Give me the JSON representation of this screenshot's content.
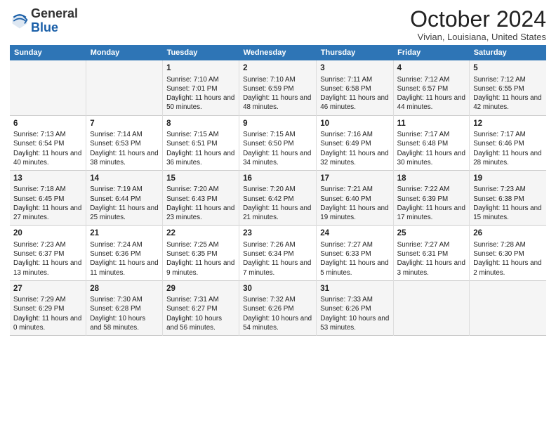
{
  "header": {
    "logo_general": "General",
    "logo_blue": "Blue",
    "month": "October 2024",
    "location": "Vivian, Louisiana, United States"
  },
  "days_of_week": [
    "Sunday",
    "Monday",
    "Tuesday",
    "Wednesday",
    "Thursday",
    "Friday",
    "Saturday"
  ],
  "weeks": [
    [
      {
        "day": "",
        "content": ""
      },
      {
        "day": "",
        "content": ""
      },
      {
        "day": "1",
        "content": "Sunrise: 7:10 AM\nSunset: 7:01 PM\nDaylight: 11 hours and 50 minutes."
      },
      {
        "day": "2",
        "content": "Sunrise: 7:10 AM\nSunset: 6:59 PM\nDaylight: 11 hours and 48 minutes."
      },
      {
        "day": "3",
        "content": "Sunrise: 7:11 AM\nSunset: 6:58 PM\nDaylight: 11 hours and 46 minutes."
      },
      {
        "day": "4",
        "content": "Sunrise: 7:12 AM\nSunset: 6:57 PM\nDaylight: 11 hours and 44 minutes."
      },
      {
        "day": "5",
        "content": "Sunrise: 7:12 AM\nSunset: 6:55 PM\nDaylight: 11 hours and 42 minutes."
      }
    ],
    [
      {
        "day": "6",
        "content": "Sunrise: 7:13 AM\nSunset: 6:54 PM\nDaylight: 11 hours and 40 minutes."
      },
      {
        "day": "7",
        "content": "Sunrise: 7:14 AM\nSunset: 6:53 PM\nDaylight: 11 hours and 38 minutes."
      },
      {
        "day": "8",
        "content": "Sunrise: 7:15 AM\nSunset: 6:51 PM\nDaylight: 11 hours and 36 minutes."
      },
      {
        "day": "9",
        "content": "Sunrise: 7:15 AM\nSunset: 6:50 PM\nDaylight: 11 hours and 34 minutes."
      },
      {
        "day": "10",
        "content": "Sunrise: 7:16 AM\nSunset: 6:49 PM\nDaylight: 11 hours and 32 minutes."
      },
      {
        "day": "11",
        "content": "Sunrise: 7:17 AM\nSunset: 6:48 PM\nDaylight: 11 hours and 30 minutes."
      },
      {
        "day": "12",
        "content": "Sunrise: 7:17 AM\nSunset: 6:46 PM\nDaylight: 11 hours and 28 minutes."
      }
    ],
    [
      {
        "day": "13",
        "content": "Sunrise: 7:18 AM\nSunset: 6:45 PM\nDaylight: 11 hours and 27 minutes."
      },
      {
        "day": "14",
        "content": "Sunrise: 7:19 AM\nSunset: 6:44 PM\nDaylight: 11 hours and 25 minutes."
      },
      {
        "day": "15",
        "content": "Sunrise: 7:20 AM\nSunset: 6:43 PM\nDaylight: 11 hours and 23 minutes."
      },
      {
        "day": "16",
        "content": "Sunrise: 7:20 AM\nSunset: 6:42 PM\nDaylight: 11 hours and 21 minutes."
      },
      {
        "day": "17",
        "content": "Sunrise: 7:21 AM\nSunset: 6:40 PM\nDaylight: 11 hours and 19 minutes."
      },
      {
        "day": "18",
        "content": "Sunrise: 7:22 AM\nSunset: 6:39 PM\nDaylight: 11 hours and 17 minutes."
      },
      {
        "day": "19",
        "content": "Sunrise: 7:23 AM\nSunset: 6:38 PM\nDaylight: 11 hours and 15 minutes."
      }
    ],
    [
      {
        "day": "20",
        "content": "Sunrise: 7:23 AM\nSunset: 6:37 PM\nDaylight: 11 hours and 13 minutes."
      },
      {
        "day": "21",
        "content": "Sunrise: 7:24 AM\nSunset: 6:36 PM\nDaylight: 11 hours and 11 minutes."
      },
      {
        "day": "22",
        "content": "Sunrise: 7:25 AM\nSunset: 6:35 PM\nDaylight: 11 hours and 9 minutes."
      },
      {
        "day": "23",
        "content": "Sunrise: 7:26 AM\nSunset: 6:34 PM\nDaylight: 11 hours and 7 minutes."
      },
      {
        "day": "24",
        "content": "Sunrise: 7:27 AM\nSunset: 6:33 PM\nDaylight: 11 hours and 5 minutes."
      },
      {
        "day": "25",
        "content": "Sunrise: 7:27 AM\nSunset: 6:31 PM\nDaylight: 11 hours and 3 minutes."
      },
      {
        "day": "26",
        "content": "Sunrise: 7:28 AM\nSunset: 6:30 PM\nDaylight: 11 hours and 2 minutes."
      }
    ],
    [
      {
        "day": "27",
        "content": "Sunrise: 7:29 AM\nSunset: 6:29 PM\nDaylight: 11 hours and 0 minutes."
      },
      {
        "day": "28",
        "content": "Sunrise: 7:30 AM\nSunset: 6:28 PM\nDaylight: 10 hours and 58 minutes."
      },
      {
        "day": "29",
        "content": "Sunrise: 7:31 AM\nSunset: 6:27 PM\nDaylight: 10 hours and 56 minutes."
      },
      {
        "day": "30",
        "content": "Sunrise: 7:32 AM\nSunset: 6:26 PM\nDaylight: 10 hours and 54 minutes."
      },
      {
        "day": "31",
        "content": "Sunrise: 7:33 AM\nSunset: 6:26 PM\nDaylight: 10 hours and 53 minutes."
      },
      {
        "day": "",
        "content": ""
      },
      {
        "day": "",
        "content": ""
      }
    ]
  ]
}
